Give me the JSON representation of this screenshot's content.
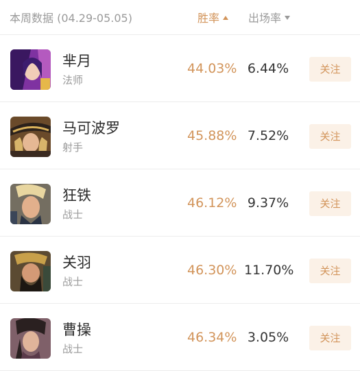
{
  "header": {
    "title": "本周数据 (04.29-05.05)",
    "sort_winrate": "胜率",
    "sort_pickrate": "出场率"
  },
  "colors": {
    "accent": "#d2945a",
    "follow_bg": "#fbf1e7",
    "muted": "#9a9a9a"
  },
  "heroes": [
    {
      "name": "芈月",
      "role": "法师",
      "win_rate": "44.03%",
      "pick_rate": "6.44%",
      "follow_label": "关注"
    },
    {
      "name": "马可波罗",
      "role": "射手",
      "win_rate": "45.88%",
      "pick_rate": "7.52%",
      "follow_label": "关注"
    },
    {
      "name": "狂铁",
      "role": "战士",
      "win_rate": "46.12%",
      "pick_rate": "9.37%",
      "follow_label": "关注"
    },
    {
      "name": "关羽",
      "role": "战士",
      "win_rate": "46.30%",
      "pick_rate": "11.70%",
      "follow_label": "关注"
    },
    {
      "name": "曹操",
      "role": "战士",
      "win_rate": "46.34%",
      "pick_rate": "3.05%",
      "follow_label": "关注"
    }
  ]
}
